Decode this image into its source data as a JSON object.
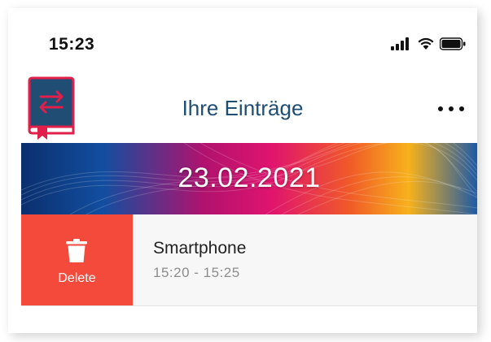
{
  "status_bar": {
    "time": "15:23",
    "icons": [
      "signal-icon",
      "wifi-icon",
      "battery-icon"
    ]
  },
  "header": {
    "title": "Ihre Einträge",
    "logo_icon": "book-swap-icon",
    "more_icon": "more-icon"
  },
  "banner": {
    "date": "23.02.2021"
  },
  "entries": [
    {
      "title": "Smartphone",
      "time": "15:20 - 15:25",
      "delete_label": "Delete",
      "delete_icon": "trash-icon"
    }
  ],
  "colors": {
    "title": "#1f4d73",
    "delete": "#f34a3c",
    "logo_red": "#e0204a",
    "logo_blue": "#1f4d73"
  }
}
